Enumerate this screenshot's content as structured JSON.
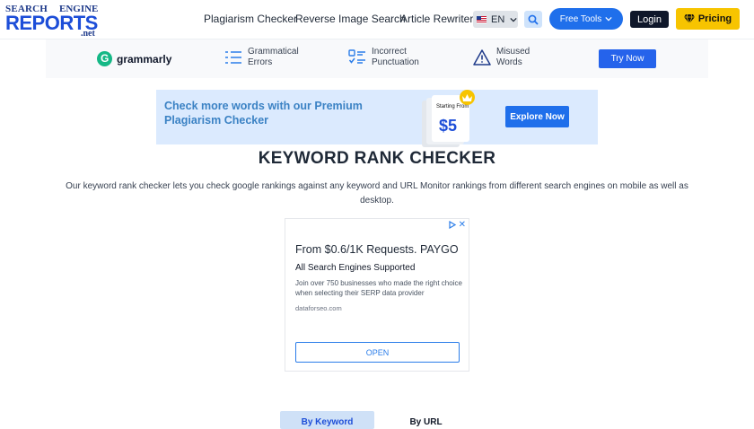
{
  "header": {
    "logo": {
      "line1": "SEARCH",
      "line1b": "ENGINE",
      "line2": "REPORTS",
      "line3": ".net"
    },
    "nav": [
      "Plagiarism Checker",
      "Reverse Image Search",
      "Article Rewriter"
    ],
    "language": "EN",
    "free_tools_label": "Free Tools",
    "login_label": "Login",
    "pricing_label": "Pricing",
    "accent": "#1f6feb",
    "pricing_color": "#f7c400"
  },
  "grammarly_bar": {
    "brand": "grammarly",
    "features": [
      {
        "line1": "Grammatical",
        "line2": "Errors",
        "icon": "list-lines-icon"
      },
      {
        "line1": "Incorrect",
        "line2": "Punctuation",
        "icon": "checklist-icon"
      },
      {
        "line1": "Misused",
        "line2": "Words",
        "icon": "warning-icon"
      }
    ],
    "cta": "Try Now"
  },
  "premium_banner": {
    "title": "Check more words with our Premium Plagiarism Checker",
    "starting_from": "Starting From",
    "price": "$5",
    "cta": "Explore Now"
  },
  "page": {
    "title": "KEYWORD RANK CHECKER",
    "description": "Our keyword rank checker lets you check google rankings against any keyword and URL Monitor rankings from different search engines on mobile as well as desktop."
  },
  "ad": {
    "headline": "From $0.6/1K Requests. PAYGO",
    "subheadline": "All Search Engines Supported",
    "body": "Join over 750 businesses who made the right choice when selecting their SERP data provider",
    "domain": "dataforseo.com",
    "cta": "OPEN"
  },
  "tabs": {
    "by_keyword": "By Keyword",
    "by_url": "By URL"
  }
}
